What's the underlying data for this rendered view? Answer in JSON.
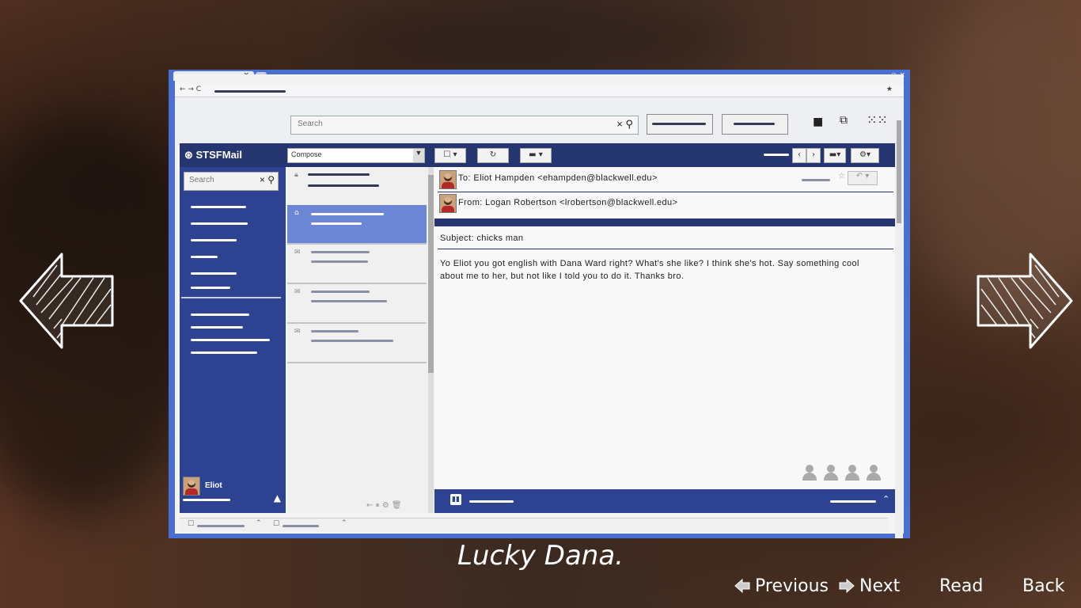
{
  "app": {
    "brand": "STSFMail",
    "search_placeholder": "Search",
    "sidebar_search_placeholder": "Search",
    "compose_label": "Compose"
  },
  "email": {
    "to": "To: Eliot Hampden <ehampden@blackwell.edu>",
    "from": "From: Logan Robertson <lrobertson@blackwell.edu>",
    "subject": "Subject: chicks man",
    "body": "Yo Eliot you got english with Dana Ward right? What's she like? I think she's hot. Say something cool about me to her, but not like I told you to do it. Thanks bro."
  },
  "profile": {
    "name": "Eliot"
  },
  "caption": "Lucky Dana.",
  "nav": {
    "previous": "Previous",
    "next": "Next",
    "read": "Read",
    "back": "Back"
  },
  "icons": {
    "left_arrow": "left-arrow-icon",
    "right_arrow": "right-arrow-icon",
    "search": "search-icon",
    "folder": "folder-icon",
    "apps": "apps-grid-icon"
  },
  "colors": {
    "window_frame": "#4b6fd0",
    "toolbar_navy": "#25356f",
    "sidebar_blue": "#2d4291",
    "selected_message": "#6c86d6"
  }
}
